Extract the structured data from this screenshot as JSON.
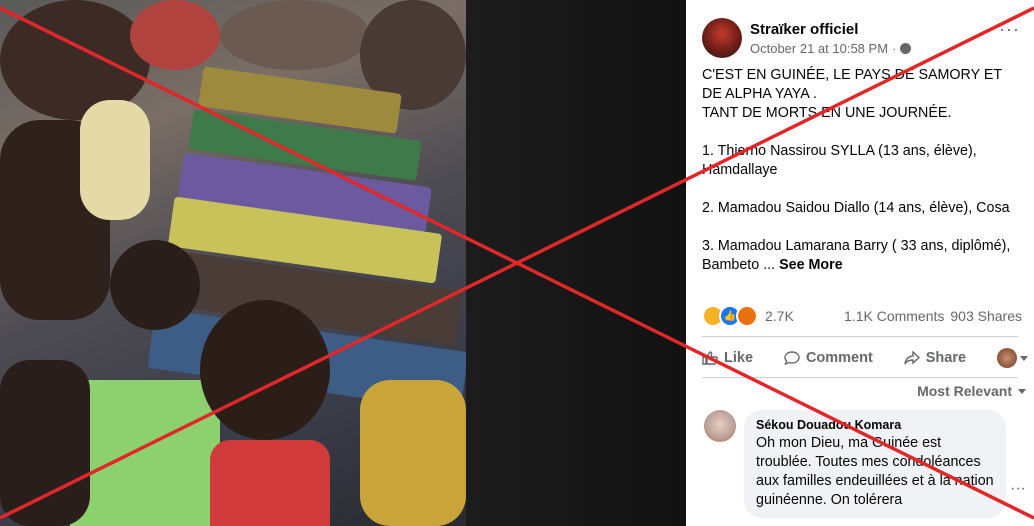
{
  "post": {
    "author": "Straïker officiel",
    "timestamp": "October 21 at 10:58 PM",
    "meta_separator": "·",
    "more_glyph": "···",
    "text": {
      "heading_line1": "C'EST EN GUINÉE, LE PAYS DE SAMORY ET DE ALPHA YAYA .",
      "heading_line2": "TANT DE MORTS EN UNE JOURNÉE.",
      "item1": "1. Thierno Nassirou SYLLA (13 ans, élève), Hamdallaye",
      "item2": "2. Mamadou Saidou Diallo (14 ans, élève), Cosa",
      "item3": "3. Mamadou Lamarana Barry ( 33 ans, diplômé), Bambeto ...",
      "see_more": "See More"
    }
  },
  "reactions": {
    "icons": [
      "sad-icon",
      "like-icon",
      "angry-icon"
    ],
    "count": "2.7K",
    "comments": "1.1K Comments",
    "shares": "903 Shares"
  },
  "actions": {
    "like": "Like",
    "comment": "Comment",
    "share": "Share"
  },
  "comments_sort": "Most Relevant",
  "comment": {
    "author": "Sékou Douadou Komara",
    "text": "Oh mon Dieu, ma Guinée est troublée. Toutes mes condoléances aux familles endeuillées et à la nation guinéenne. On tolérera"
  },
  "colors": {
    "cross": "#e0282a",
    "panel_bg": "#ffffff",
    "secondary_text": "#65676b",
    "like_blue": "#1877f2"
  }
}
